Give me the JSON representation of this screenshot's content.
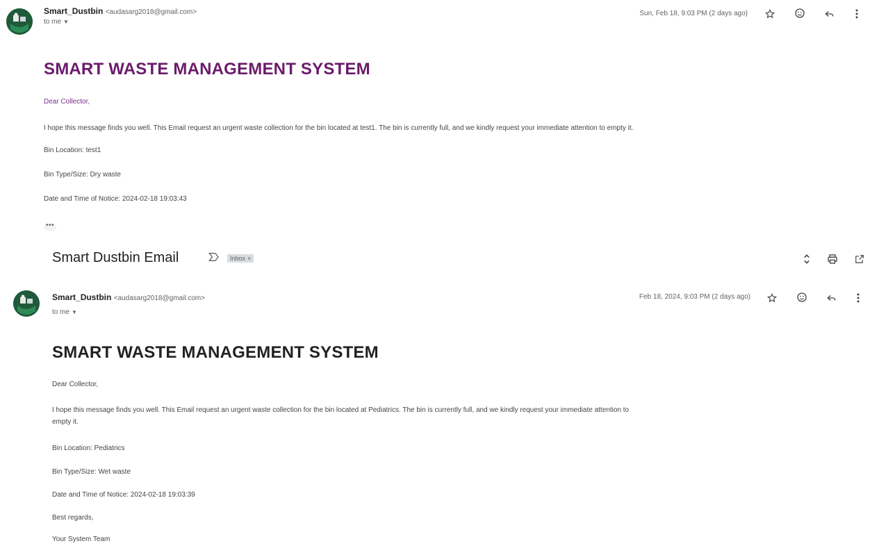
{
  "email1": {
    "sender_name": "Smart_Dustbin",
    "sender_email": "<audasarg2018@gmail.com>",
    "to": "to me",
    "date": "Sun, Feb 18, 9:03 PM (2 days ago)",
    "heading": "SMART WASTE MANAGEMENT SYSTEM",
    "greeting": "Dear Collector,",
    "message": "I hope this message finds you well. This Email request an urgent waste collection for the bin located at test1. The bin is currently full, and we kindly request your immediate attention to empty it.",
    "bin_location": "Bin Location: test1",
    "bin_type": "Bin Type/Size: Dry waste",
    "notice_time": "Date and Time of Notice: 2024-02-18 19:03:43",
    "trimmed": "•••"
  },
  "thread": {
    "subject": "Smart Dustbin Email",
    "label": "Inbox",
    "label_close": "×"
  },
  "email2": {
    "sender_name": "Smart_Dustbin",
    "sender_email": "<audasarg2018@gmail.com>",
    "to": "to me",
    "date": "Feb 18, 2024, 9:03 PM (2 days ago)",
    "heading": "SMART WASTE MANAGEMENT SYSTEM",
    "greeting": "Dear Collector,",
    "message_line1": "I hope this message finds you well. This Email request an urgent waste collection for the bin located at Pediatrics. The bin is currently full, and we kindly request your immediate attention to",
    "message_line2": "empty it.",
    "bin_location": "Bin Location: Pediatrics",
    "bin_type": "Bin Type/Size: Wet waste",
    "notice_time": "Date and Time of Notice: 2024-02-18 19:03:39",
    "regards": "Best regards,",
    "signature": "Your System Team"
  },
  "icons": {
    "star": "star-icon",
    "emoji": "emoji-icon",
    "reply": "reply-icon",
    "more": "more-vert-icon",
    "expand": "unfold-icon",
    "print": "print-icon",
    "new_window": "open-in-new-icon",
    "important": "important-marker-icon"
  },
  "colors": {
    "heading_purple": "#6b1b6b",
    "greeting_purple": "#7b2d8e",
    "avatar_green": "#1f5a3a"
  }
}
